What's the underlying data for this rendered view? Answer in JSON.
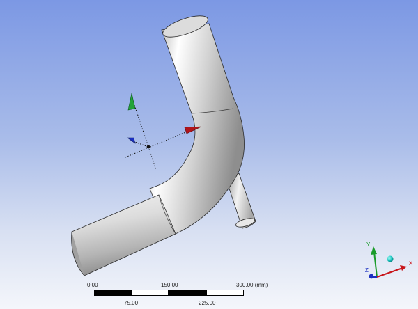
{
  "scale_bar": {
    "top_ticks": [
      "0.00",
      "150.00",
      "300.00 (mm)"
    ],
    "bottom_ticks": [
      "75.00",
      "225.00"
    ]
  },
  "triad": {
    "x_label": "X",
    "y_label": "Y",
    "z_label": "Z",
    "x_color": "#c8151b",
    "y_color": "#1a9b2a",
    "z_color": "#1a2fc0",
    "iso_ball_color": "#16c6c0"
  },
  "coordinate_system": {
    "x_color": "#b0151b",
    "y_color": "#22a33a",
    "z_color": "#1a2fc0"
  },
  "model": {
    "surface_color": "#c9c9c9",
    "edge_color": "#2a2a2a"
  }
}
